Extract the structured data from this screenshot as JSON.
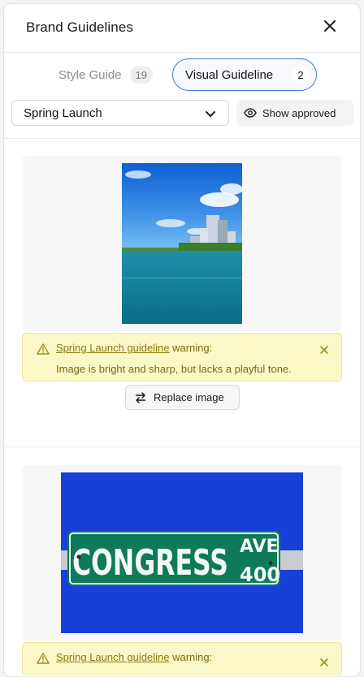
{
  "header": {
    "title": "Brand Guidelines",
    "close_icon": "close-icon"
  },
  "tabs": [
    {
      "label": "Style Guide",
      "count": "19",
      "active": false
    },
    {
      "label": "Visual Guideline",
      "count": "2",
      "active": true
    }
  ],
  "filters": {
    "campaign_value": "Spring Launch",
    "show_approved_label": "Show approved"
  },
  "cards": [
    {
      "image_alt": "City skyline beside a river under a blue sky",
      "warning": {
        "link_text": "Spring Launch guideline",
        "suffix": " warning:",
        "message": "Image is bright and sharp, but lacks a playful tone."
      },
      "replace_label": "Replace image"
    },
    {
      "image_alt": "Green street sign reading CONGRESS AVE 400",
      "sign_main": "CONGRESS",
      "sign_ave": "AVE",
      "sign_num": "400",
      "warning": {
        "link_text": "Spring Launch guideline",
        "suffix": " warning:"
      }
    }
  ],
  "colors": {
    "accent": "#3f7ad6",
    "warning_bg": "#fbf7c7",
    "warning_text": "#7a6a0f"
  }
}
